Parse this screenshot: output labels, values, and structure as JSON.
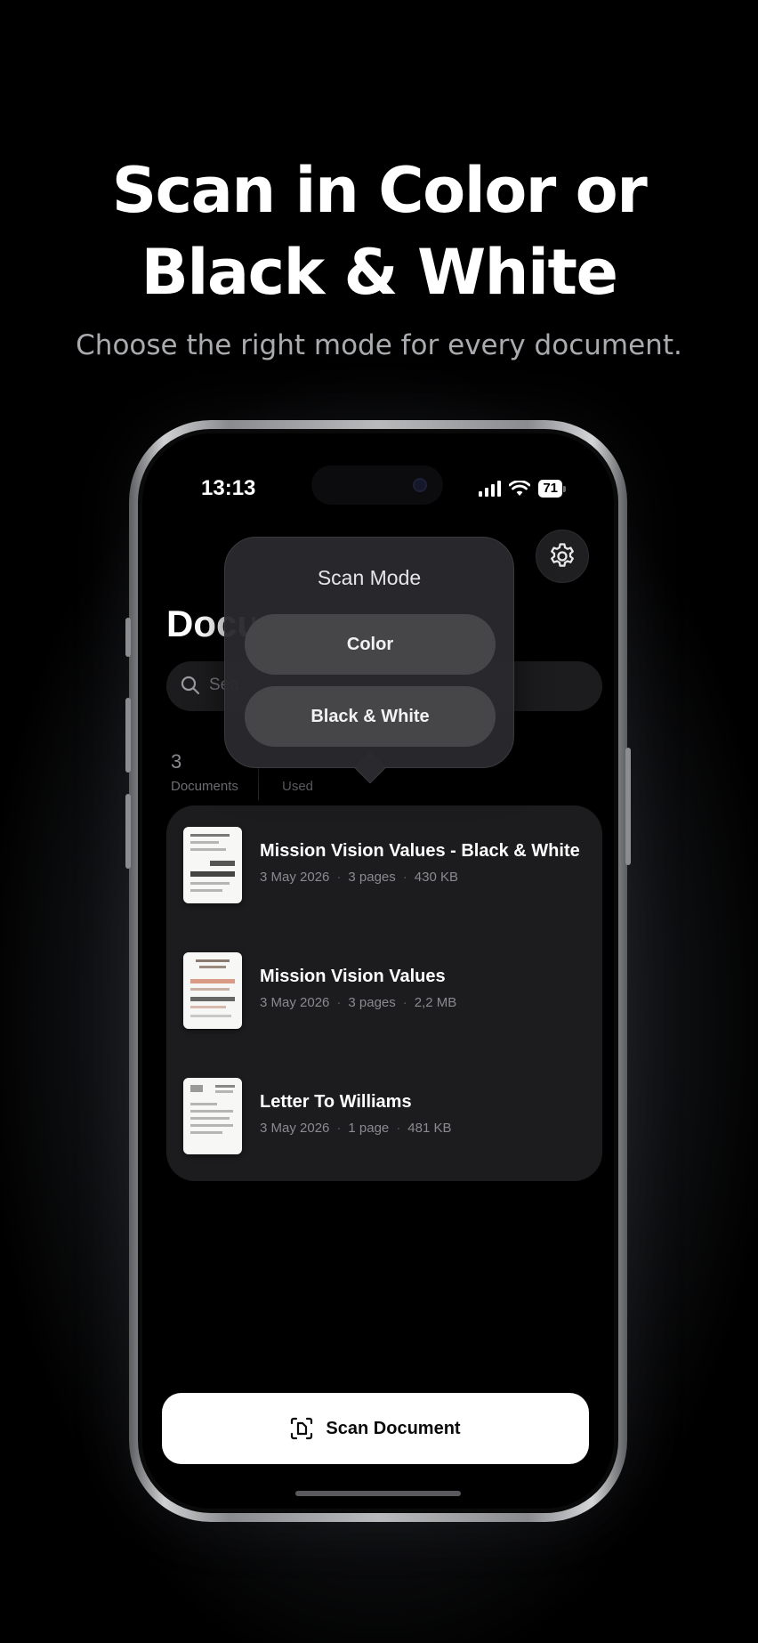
{
  "promo": {
    "headline_line1": "Scan in Color or",
    "headline_line2": "Black & White",
    "subheadline": "Choose the right mode for every document."
  },
  "status_bar": {
    "time": "13:13",
    "battery": "71",
    "icons": [
      "signal-icon",
      "wifi-icon",
      "battery-icon"
    ]
  },
  "header": {
    "title_visible": "Docu",
    "settings_icon": "gear-icon"
  },
  "search": {
    "placeholder_visible": "Sea"
  },
  "stats": {
    "document_count": "3",
    "documents_label": "Documents",
    "used_label": "Used"
  },
  "scan_mode_menu": {
    "title": "Scan Mode",
    "options": [
      "Color",
      "Black & White"
    ]
  },
  "documents": [
    {
      "name": "Mission Vision Values - Black & White",
      "date": "3 May 2026",
      "pages": "3 pages",
      "size": "430 KB"
    },
    {
      "name": "Mission Vision Values",
      "date": "3 May 2026",
      "pages": "3 pages",
      "size": "2,2 MB"
    },
    {
      "name": "Letter To Williams",
      "date": "3 May 2026",
      "pages": "1 page",
      "size": "481 KB"
    }
  ],
  "actions": {
    "scan_label": "Scan Document",
    "scan_icon": "document-scan-icon"
  }
}
